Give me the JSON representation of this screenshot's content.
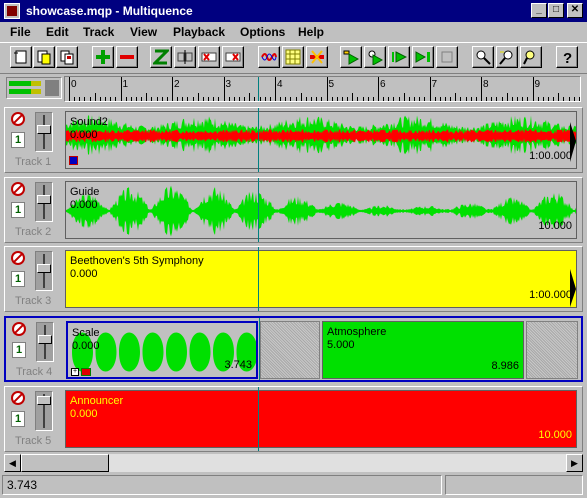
{
  "window": {
    "title": "showcase.mqp - Multiquence"
  },
  "menu": [
    "File",
    "Edit",
    "Track",
    "View",
    "Playback",
    "Options",
    "Help"
  ],
  "ruler": {
    "labels": [
      "0",
      "1",
      "2",
      "3",
      "4",
      "5",
      "6",
      "7",
      "8",
      "9"
    ]
  },
  "tracks": [
    {
      "name": "Track 1",
      "number": "1",
      "clips": [
        {
          "title": "Sound2",
          "start": "0.000",
          "end": "1:00.000",
          "color": "#c0c0c0"
        }
      ]
    },
    {
      "name": "Track 2",
      "number": "1",
      "clips": [
        {
          "title": "Guide",
          "start": "0.000",
          "end": "10.000",
          "color": "#c0c0c0"
        }
      ]
    },
    {
      "name": "Track 3",
      "number": "1",
      "clips": [
        {
          "title": "Beethoven's 5th Symphony",
          "start": "0.000",
          "end": "1:00.000",
          "color": "#ffff00"
        }
      ]
    },
    {
      "name": "Track 4",
      "number": "1",
      "clips": [
        {
          "title": "Scale",
          "start": "0.000",
          "end": "3.743",
          "color": "#c0c0c0"
        },
        {
          "title": "Atmosphere",
          "start": "5.000",
          "end": "8.986",
          "color": "#00e000"
        }
      ]
    },
    {
      "name": "Track 5",
      "number": "1",
      "clips": [
        {
          "title": "Announcer",
          "start": "0.000",
          "end": "10.000",
          "color": "#ff0000"
        }
      ]
    }
  ],
  "status": {
    "text": "3.743"
  },
  "colors": {
    "waveform_green": "#00e000",
    "waveform_red": "#ff0000",
    "cursor": "#008080",
    "selection": "#0000c0"
  }
}
